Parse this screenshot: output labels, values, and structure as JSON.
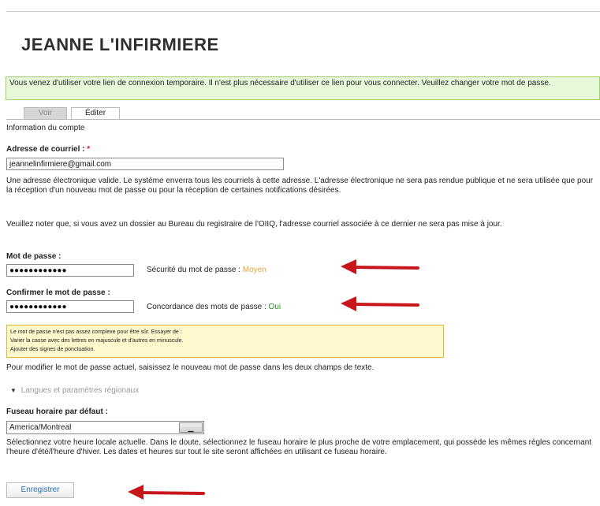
{
  "page": {
    "title": "JEANNE L'INFIRMIERE"
  },
  "status_message": "Vous venez d'utiliser votre lien de connexion temporaire. Il n'est plus nécessaire d'utiliser ce lien pour vous connecter. Veuillez changer votre mot de passe.",
  "tabs": [
    {
      "label": "Voir",
      "active": false
    },
    {
      "label": "Éditer",
      "active": true
    }
  ],
  "section_heading": "Information du compte",
  "email": {
    "label": "Adresse de courriel :",
    "required_mark": "*",
    "value": "jeannelinfirmiere@gmail.com",
    "help_1": "Une adresse électronique valide. Le système enverra tous les courriels à cette adresse. L'adresse électronique ne sera pas rendue publique et ne sera utilisée que pour la réception d'un nouveau mot de passe ou pour la réception de certaines notifications désirées.",
    "help_2": "Veuillez noter que, si vous avez un dossier au Bureau du registraire de l'OIIQ, l'adresse courriel associée à ce dernier ne sera pas mise à jour."
  },
  "password": {
    "label": "Mot de passe :",
    "value": "●●●●●●●●●●●●",
    "strength_label": "Sécurité du mot de passe :",
    "strength_value": "Moyen"
  },
  "confirm_password": {
    "label": "Confirmer le mot de passe :",
    "value": "●●●●●●●●●●●●",
    "match_label": "Concordance des mots de passe :",
    "match_value": "Oui"
  },
  "password_tips": {
    "line_1": "Le mot de passe n'est pas assez complexe pour être sûr. Essayer de :",
    "line_2": "Varier la casse avec des lettres en majuscule et d'autres en minuscule.",
    "line_3": "Ajouter des signes de ponctuation."
  },
  "password_help": "Pour modifier le mot de passe actuel, saisissez le nouveau mot de passe dans les deux champs de texte.",
  "locale_section": {
    "label": "Langues et paramètres régionaux"
  },
  "timezone": {
    "label": "Fuseau horaire par défaut :",
    "selected": "America/Montreal",
    "help": "Sélectionnez votre heure locale actuelle. Dans le doute, sélectionnez le fuseau horaire le plus proche de votre emplacement, qui possède les mêmes règles concernant l'heure d'été/l'heure d'hiver. Les dates et heures sur tout le site seront affichées en utilisant ce fuseau horaire."
  },
  "submit": {
    "label": "Enregistrer"
  },
  "colors": {
    "arrow": "#c8171b",
    "status_bg": "#e6f8d8",
    "warning_bg": "#fff8cc",
    "strength_medium": "#e8a33a",
    "match_ok": "#2a8f2a"
  }
}
